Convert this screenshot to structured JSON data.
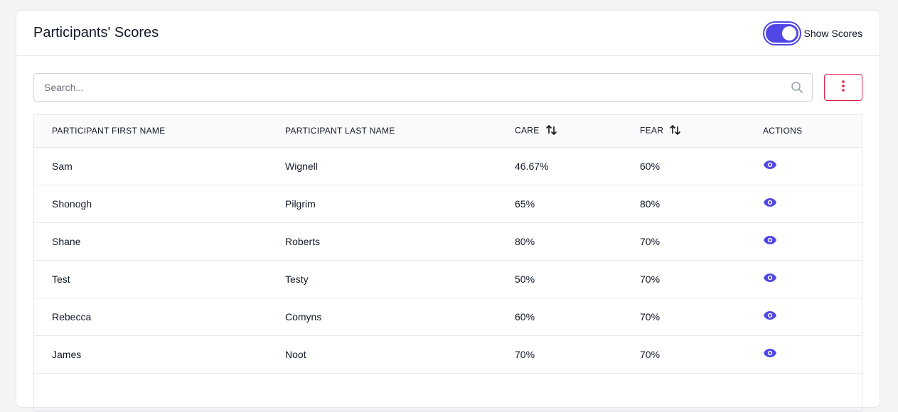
{
  "header": {
    "title": "Participants' Scores",
    "toggle_label": "Show Scores",
    "toggle_on": true
  },
  "search": {
    "placeholder": "Search..."
  },
  "colors": {
    "accent": "#4f46e5",
    "more_button": "#e11d48"
  },
  "table": {
    "columns": [
      "PARTICIPANT FIRST NAME",
      "PARTICIPANT LAST NAME",
      "CARE",
      "FEAR",
      "ACTIONS"
    ],
    "rows": [
      {
        "first": "Sam",
        "last": "Wignell",
        "care": "46.67%",
        "fear": "60%"
      },
      {
        "first": "Shonogh",
        "last": "Pilgrim",
        "care": "65%",
        "fear": "80%"
      },
      {
        "first": "Shane",
        "last": "Roberts",
        "care": "80%",
        "fear": "70%"
      },
      {
        "first": "Test",
        "last": "Testy",
        "care": "50%",
        "fear": "70%"
      },
      {
        "first": "Rebecca",
        "last": "Comyns",
        "care": "60%",
        "fear": "70%"
      },
      {
        "first": "James",
        "last": "Noot",
        "care": "70%",
        "fear": "70%"
      },
      {
        "first": "",
        "last": "",
        "care": "",
        "fear": ""
      }
    ],
    "action_icon": "eye-icon",
    "sort_icon": "sort-arrows-icon"
  }
}
